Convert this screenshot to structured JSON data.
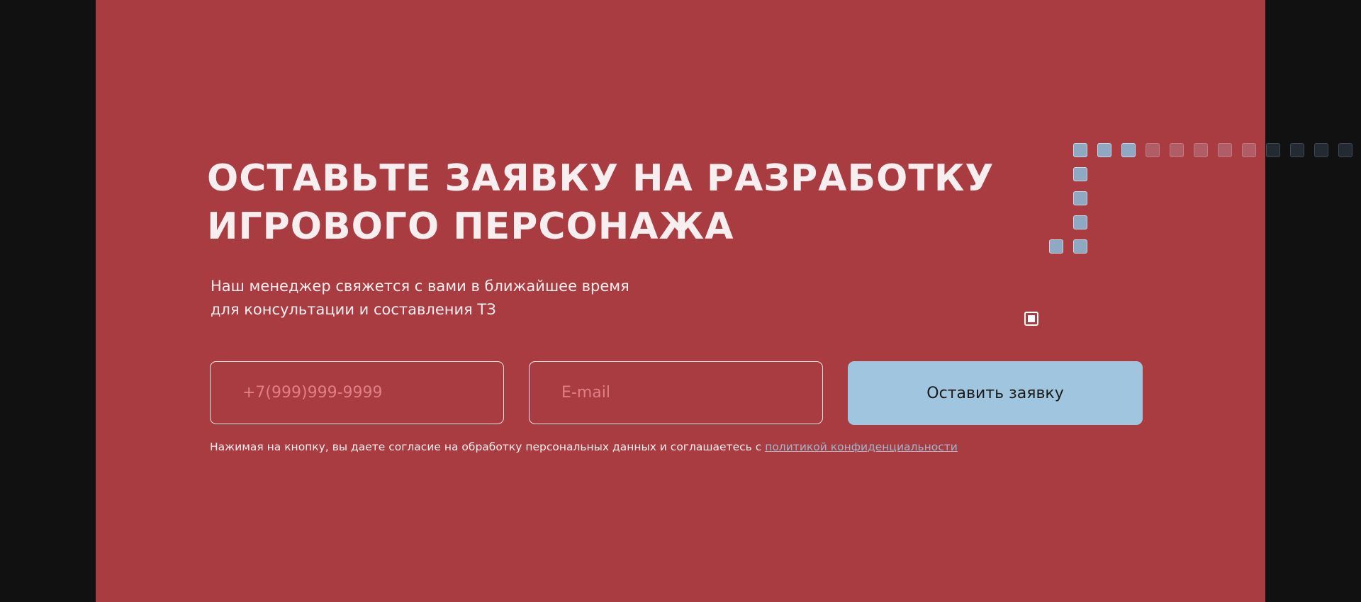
{
  "headline": {
    "line1": "ОСТАВЬТЕ ЗАЯВКУ НА РАЗРАБОТКУ",
    "line2": "ИГРОВОГО ПЕРСОНАЖА"
  },
  "subtitle": {
    "line1": "Наш менеджер свяжется с вами в ближайшее время",
    "line2": "для консультации и составления ТЗ"
  },
  "form": {
    "phone_placeholder": "+7(999)999-9999",
    "phone_value": "",
    "email_placeholder": "E-mail",
    "email_value": "",
    "submit_label": "Оставить заявку"
  },
  "consent": {
    "text": "Нажимая на кнопку, вы даете согласие на обработку персональных данных и соглашаетесь с ",
    "link_text": "политикой конфиденциальности"
  },
  "colors": {
    "background": "#111111",
    "panel": "#a83c40",
    "button": "#9fc5df",
    "text": "#f7eef0",
    "placeholder": "#e07f86",
    "link": "#9fb5c7"
  }
}
